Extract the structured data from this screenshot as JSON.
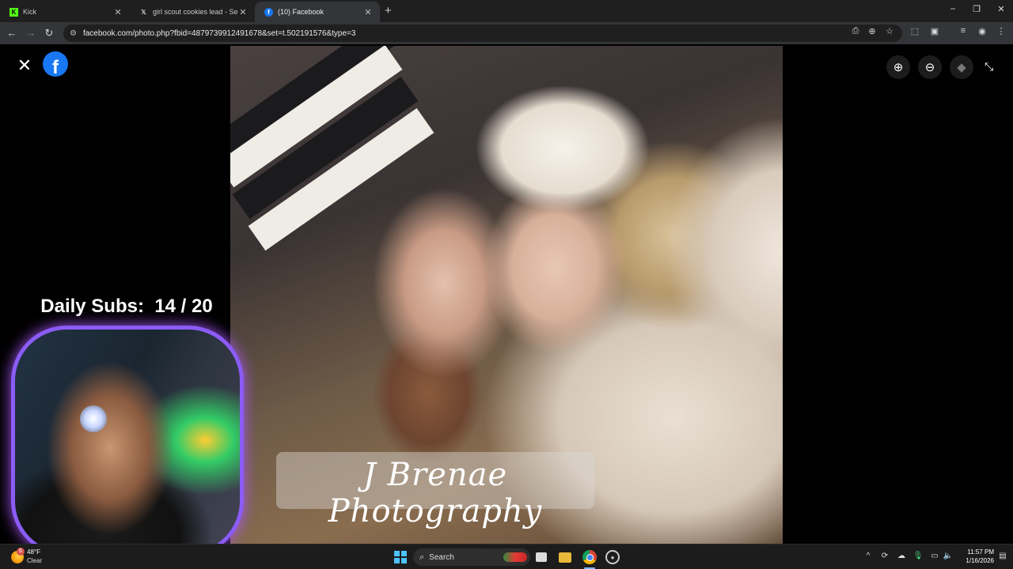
{
  "browser": {
    "tabs": [
      {
        "favicon": "kick-icon",
        "title": "Kick",
        "active": false
      },
      {
        "favicon": "x-icon",
        "title": "girl scout cookies lead - Search",
        "active": false
      },
      {
        "favicon": "facebook-icon",
        "title": "(10) Facebook",
        "active": true
      }
    ],
    "new_tab_label": "+",
    "url": "facebook.com/photo.php?fbid=4879739912491678&set=t.502191576&type=3"
  },
  "viewer": {
    "watermark": "J Brenae Photography",
    "controls": [
      "zoom-in-icon",
      "zoom-out-icon",
      "tag-icon",
      "exit-fullscreen-icon"
    ]
  },
  "stream_overlay": {
    "subs_label": "Daily Subs:",
    "subs_count": "14 / 20"
  },
  "taskbar": {
    "weather_temp": "48°F",
    "weather_cond": "Clear",
    "weather_badge": "6",
    "search_label": "Search",
    "time": "11:57 PM",
    "date": "1/16/2026"
  },
  "colors": {
    "facebook_blue": "#1877f2",
    "chrome_dark": "#1f1f1f",
    "toolbar": "#333538",
    "webcam_border": "#8b5cf6"
  }
}
